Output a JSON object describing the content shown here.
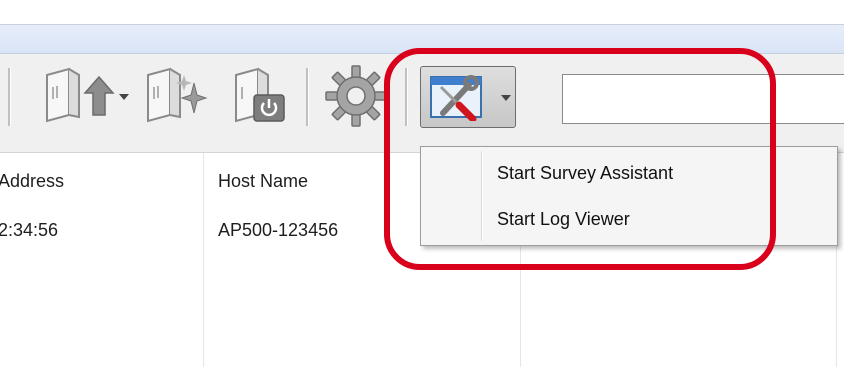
{
  "toolbar": {
    "buttons": [
      {
        "icon": "upload-firmware-icon",
        "has_dropdown": true
      },
      {
        "icon": "discover-device-icon",
        "has_dropdown": false
      },
      {
        "icon": "reboot-device-icon",
        "has_dropdown": false
      },
      {
        "icon": "settings-gear-icon",
        "has_dropdown": false
      },
      {
        "icon": "tools-wrench-screwdriver-icon",
        "has_dropdown": true,
        "pressed": true
      }
    ],
    "search": {
      "value": "",
      "placeholder": ""
    }
  },
  "table": {
    "columns": [
      "Address",
      "Host Name"
    ],
    "rows": [
      [
        "2:34:56",
        "AP500-123456"
      ]
    ]
  },
  "tools_menu": {
    "items": [
      {
        "label": "Start Survey Assistant"
      },
      {
        "label": "Start Log Viewer"
      }
    ]
  },
  "colors": {
    "highlight": "#d9001b",
    "toolbar_bg": "#f0f0f0",
    "title_band": "#dfe8f7"
  }
}
